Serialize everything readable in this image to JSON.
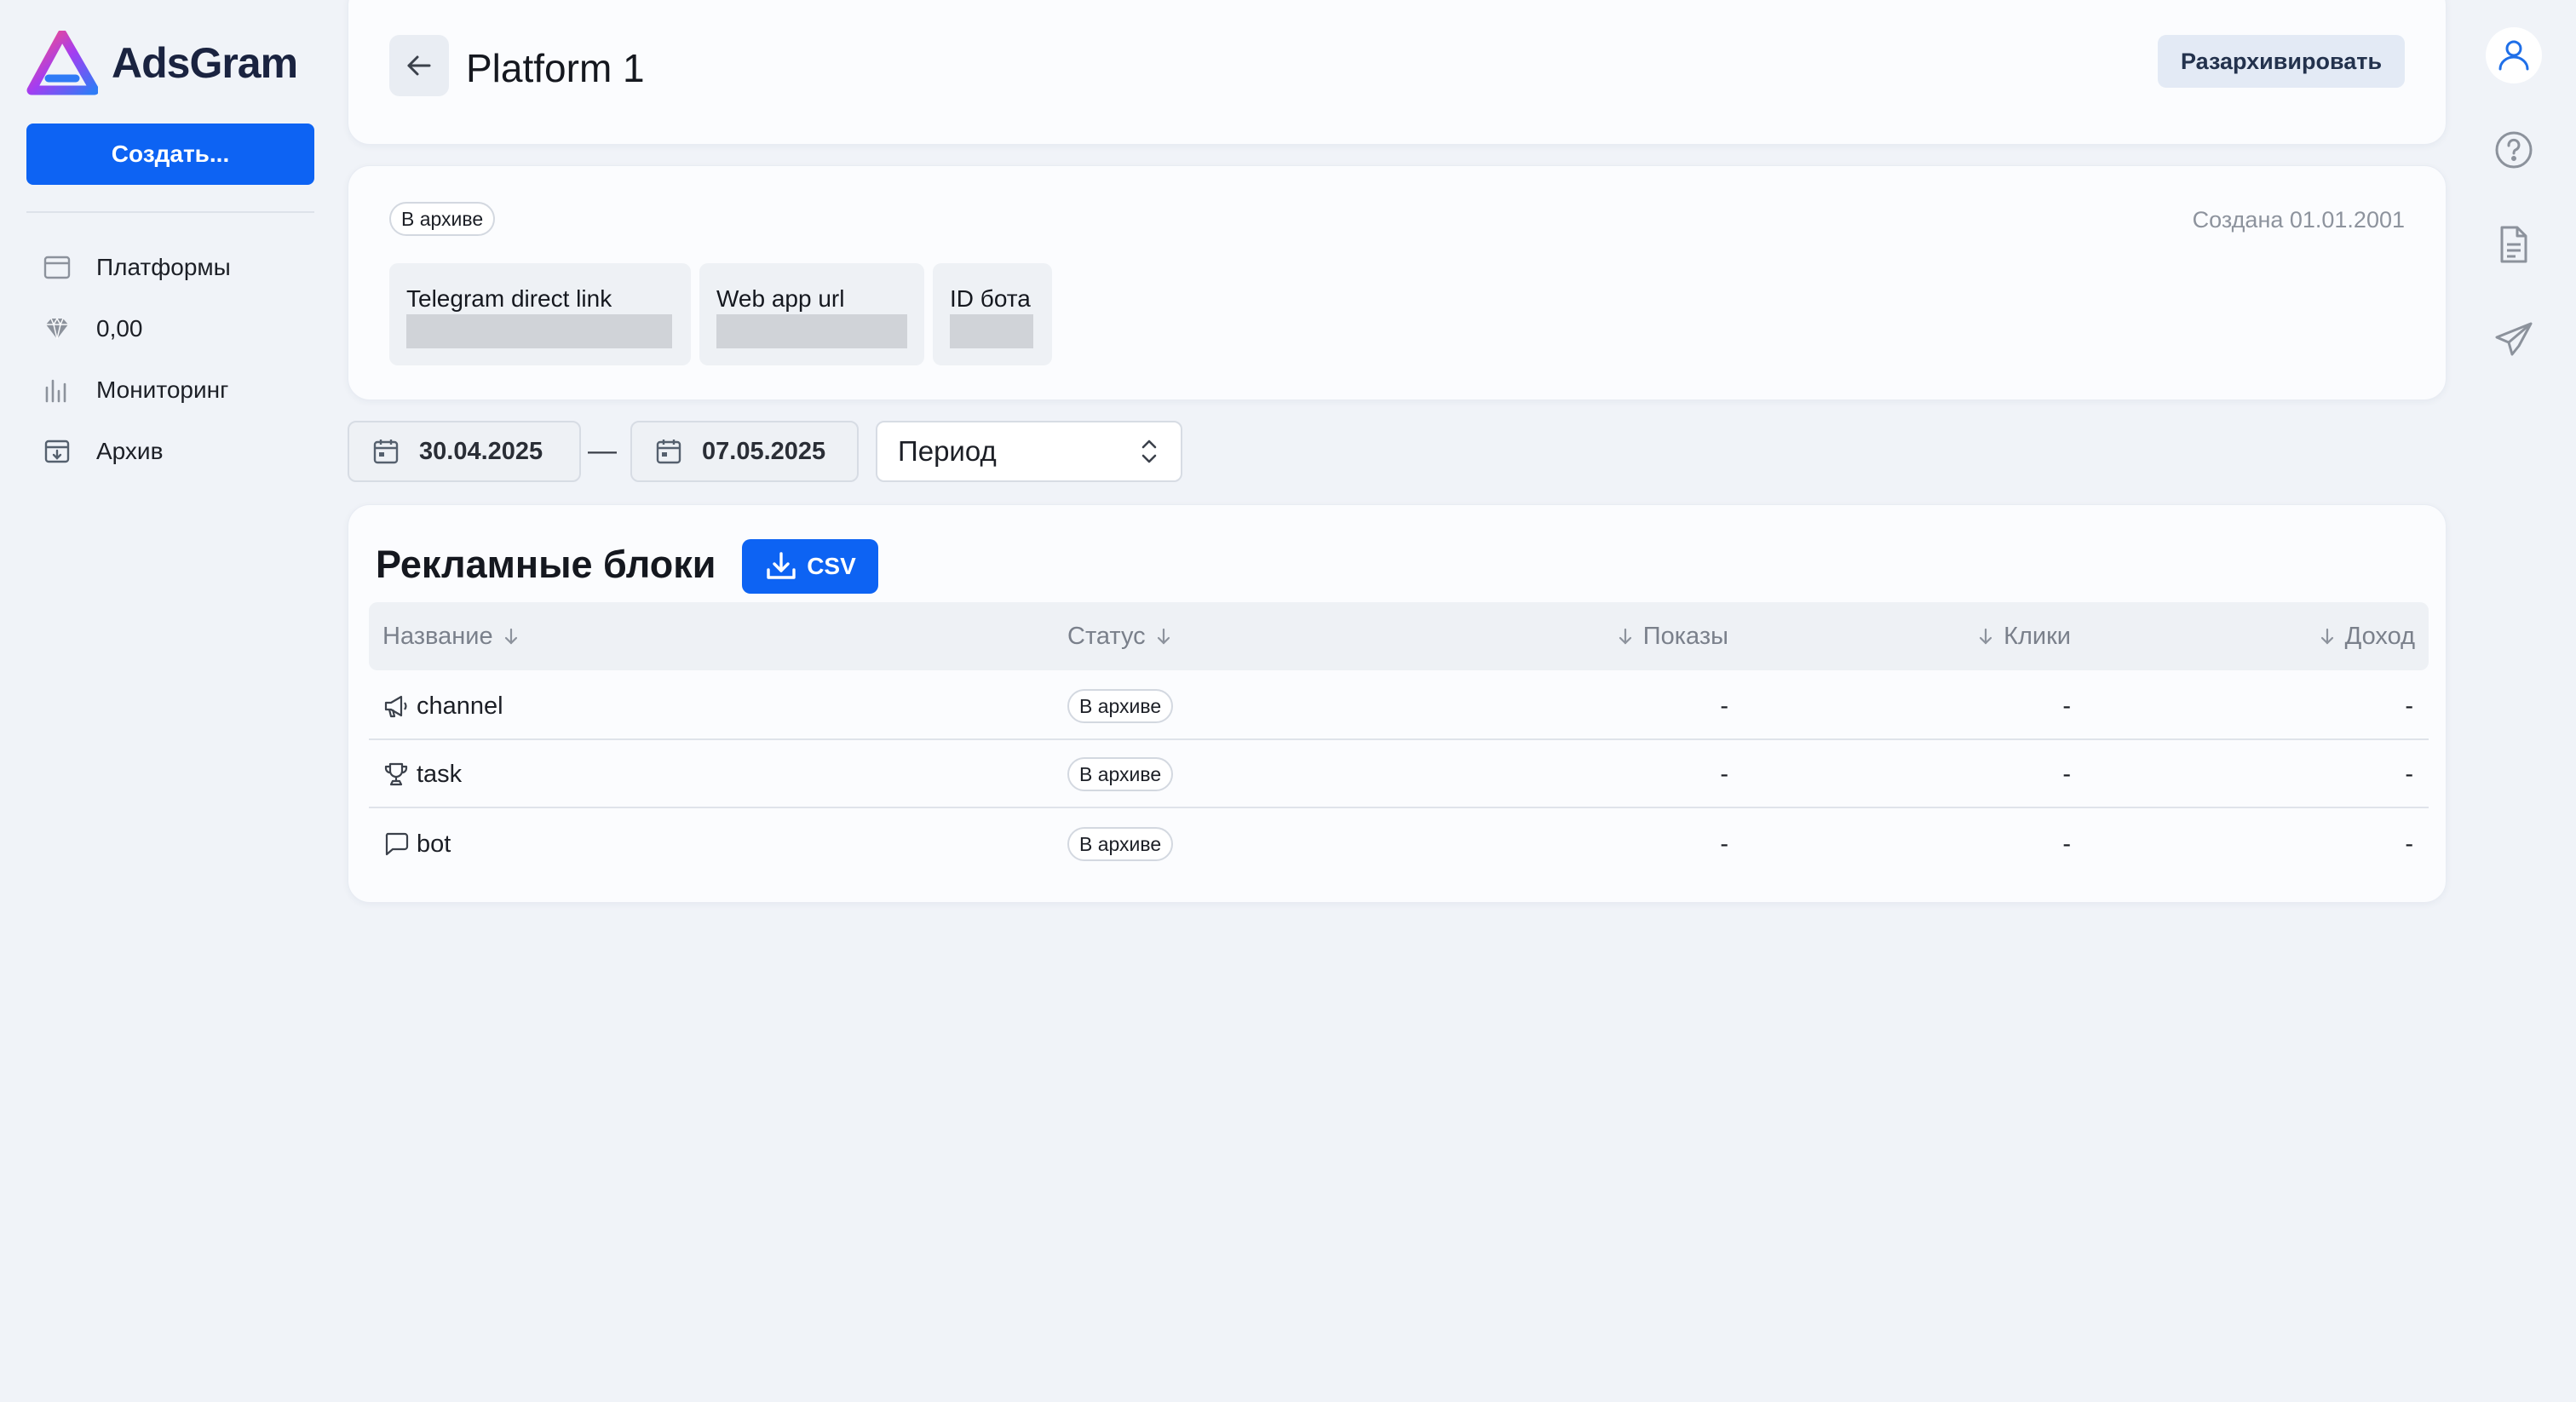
{
  "app": {
    "brand_name": "AdsGram",
    "accent_color": "#0d63f3"
  },
  "sidebar": {
    "create_label": "Создать...",
    "items": [
      {
        "label": "Платформы",
        "icon": "browser-window-icon"
      },
      {
        "label": "0,00",
        "icon": "diamond-icon"
      },
      {
        "label": "Мониторинг",
        "icon": "bar-chart-icon"
      },
      {
        "label": "Архив",
        "icon": "archive-box-icon"
      }
    ]
  },
  "header": {
    "title": "Platform 1",
    "unarchive_label": "Разархивировать"
  },
  "info": {
    "status_badge": "В архиве",
    "created_text": "Создана 01.01.2001",
    "links": [
      {
        "label": "Telegram direct link"
      },
      {
        "label": "Web app url"
      },
      {
        "label": "ID бота"
      }
    ]
  },
  "filters": {
    "date_from": "30.04.2025",
    "date_separator": "—",
    "date_to": "07.05.2025",
    "period_label": "Период"
  },
  "ad_blocks": {
    "title": "Рекламные блоки",
    "csv_label": "CSV",
    "columns": [
      "Название",
      "Статус",
      "Показы",
      "Клики",
      "Доход"
    ],
    "rows": [
      {
        "name": "channel",
        "icon": "megaphone-icon",
        "status": "В архиве",
        "impressions": "-",
        "clicks": "-",
        "revenue": "-"
      },
      {
        "name": "task",
        "icon": "trophy-icon",
        "status": "В архиве",
        "impressions": "-",
        "clicks": "-",
        "revenue": "-"
      },
      {
        "name": "bot",
        "icon": "chat-bubble-icon",
        "status": "В архиве",
        "impressions": "-",
        "clicks": "-",
        "revenue": "-"
      }
    ]
  },
  "right_rail": {
    "icons": [
      "user-icon",
      "help-icon",
      "document-icon",
      "send-icon"
    ]
  }
}
